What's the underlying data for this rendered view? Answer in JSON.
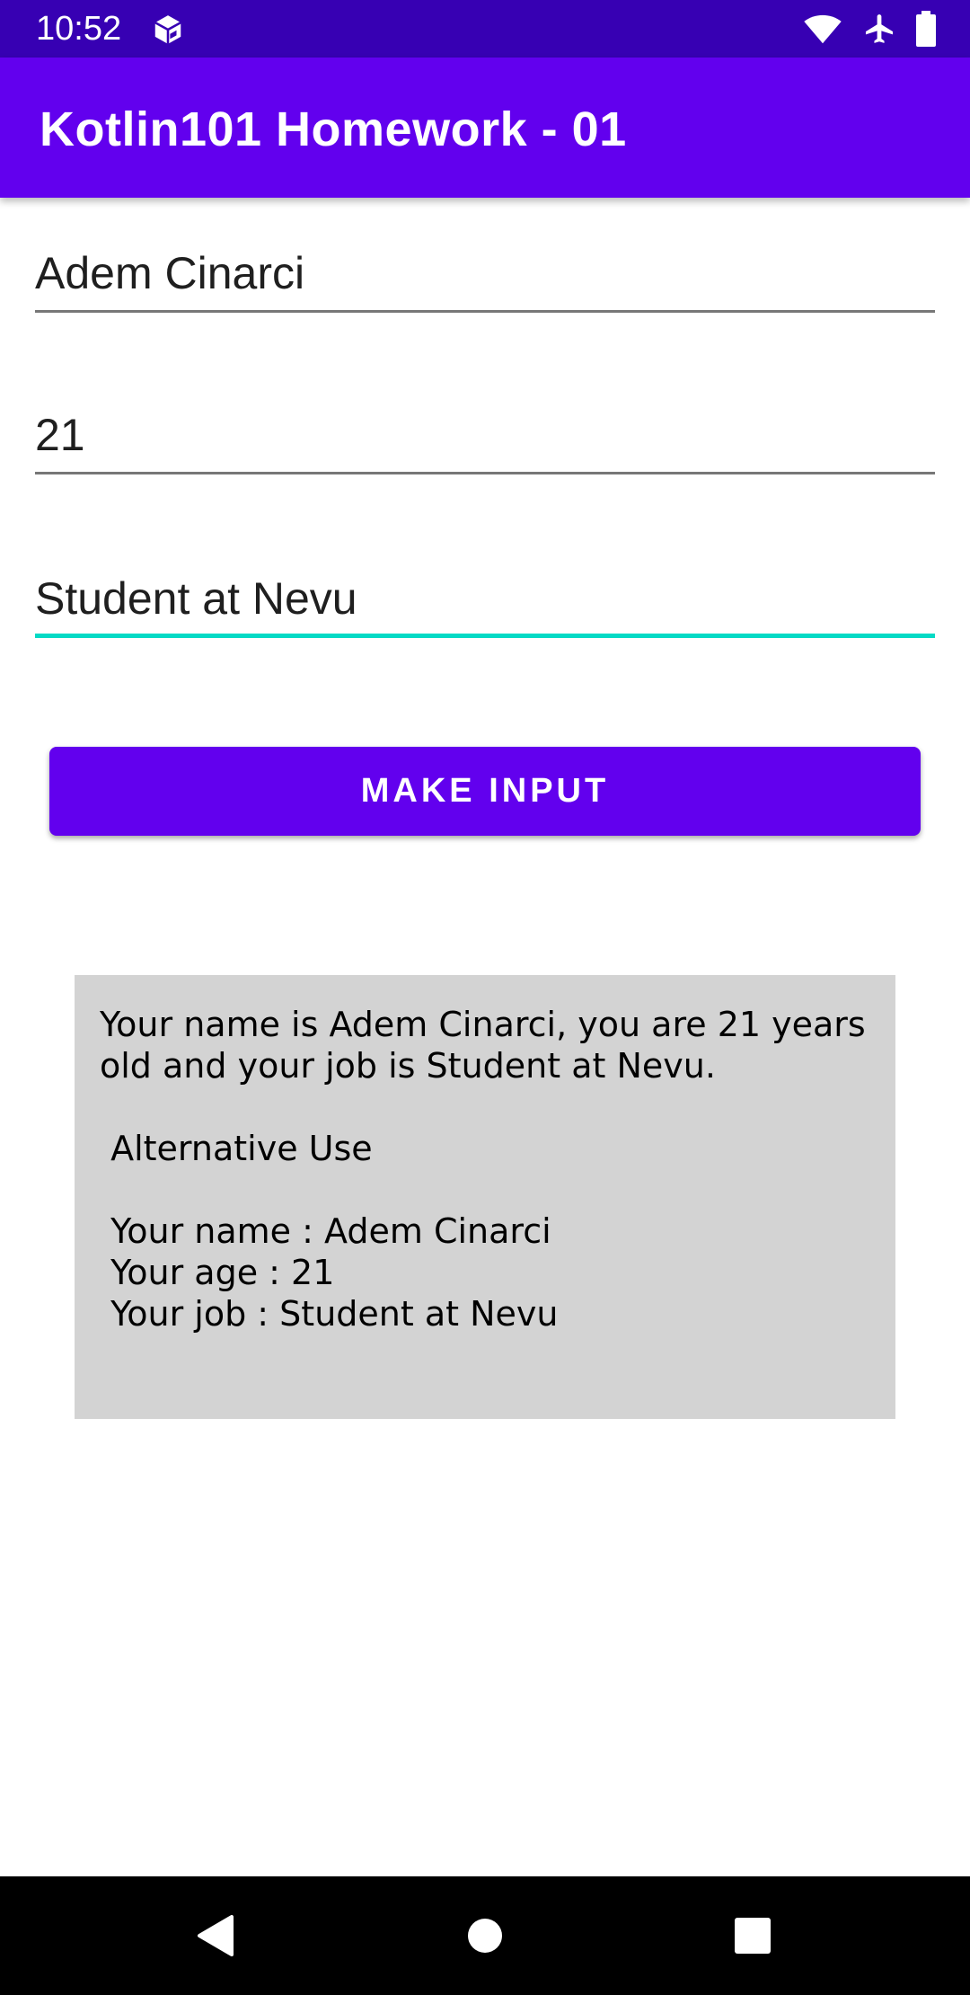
{
  "status_bar": {
    "time": "10:52",
    "icons": [
      "cube-notification-icon",
      "wifi-icon",
      "airplane-icon",
      "battery-icon"
    ]
  },
  "app_bar": {
    "title": "Kotlin101 Homework - 01"
  },
  "form": {
    "name_value": "Adem Cinarci",
    "age_value": "21",
    "job_value": "Student at Nevu",
    "button_label": "MAKE INPUT"
  },
  "result": {
    "text": "Your name is Adem Cinarci, you are 21 years old and your job is Student at Nevu.\n\n Alternative Use\n\n Your name : Adem Cinarci\n Your age : 21\n Your job : Student at Nevu"
  },
  "navigation": {
    "icons": [
      "back-icon",
      "home-icon",
      "recents-icon"
    ]
  },
  "colors": {
    "status_bar": "#3700b3",
    "primary": "#6200ee",
    "accent": "#03dac5",
    "result_background": "#d3d3d3"
  }
}
